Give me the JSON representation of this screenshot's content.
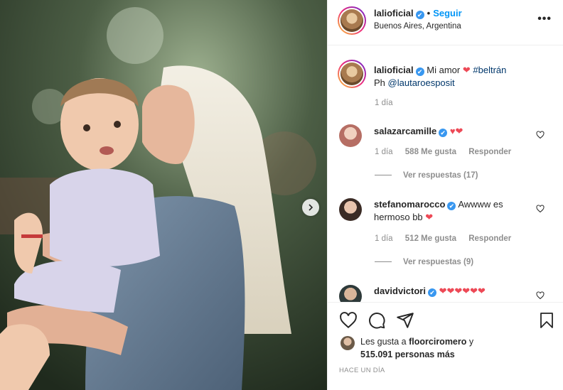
{
  "header": {
    "username": "lalioficial",
    "verified_mark": "✔",
    "separator": "•",
    "follow_label": "Seguir",
    "location": "Buenos Aires, Argentina",
    "more_label": "•••"
  },
  "caption": {
    "username": "lalioficial",
    "text_before": "Mi amor",
    "heart": "❤",
    "hashtag": "#beltrán",
    "credit_prefix": "Ph",
    "mention": "@lautaroesposit",
    "time": "1 día"
  },
  "comments": [
    {
      "username": "salazarcamille",
      "text": "♥❤",
      "time": "1 día",
      "likes": "588 Me gusta",
      "reply_label": "Responder",
      "view_replies": "Ver respuestas (17)"
    },
    {
      "username": "stefanomarocco",
      "text_line1": "Awwww es",
      "text_line2": "hermoso bb",
      "heart": "❤",
      "time": "1 día",
      "likes": "512 Me gusta",
      "reply_label": "Responder",
      "view_replies": "Ver respuestas (9)"
    },
    {
      "username": "davidvictori",
      "text": "❤❤❤❤❤❤"
    }
  ],
  "likes": {
    "prefix": "Les gusta a",
    "liker": "floorciromero",
    "conj": "y",
    "count_line": "515.091 personas más"
  },
  "timestamp": "HACE UN DÍA",
  "icons": [
    "heart-icon",
    "comment-icon",
    "share-icon",
    "bookmark-icon",
    "next-arrow-icon"
  ],
  "colors": {
    "link": "#0095f6",
    "verified": "#3897f0",
    "heart": "#ed4956"
  }
}
